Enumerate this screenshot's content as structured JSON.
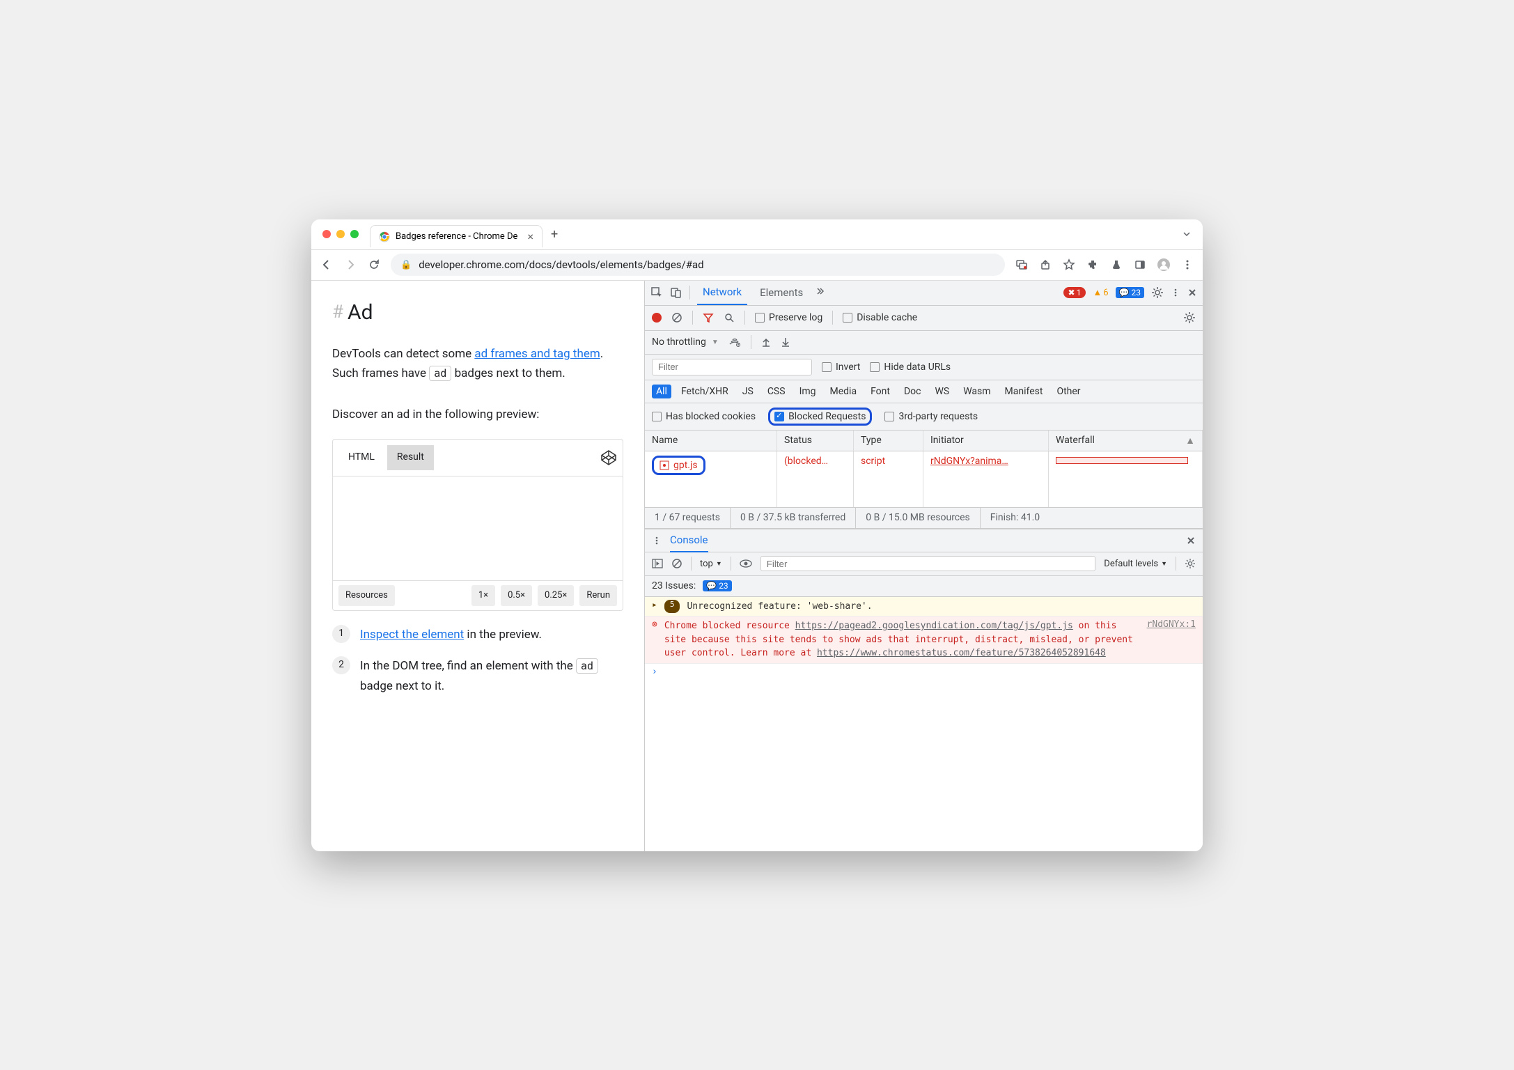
{
  "browser": {
    "tab_title": "Badges reference - Chrome De",
    "url": "developer.chrome.com/docs/devtools/elements/badges/#ad"
  },
  "page": {
    "heading": "Ad",
    "para1_prefix": "DevTools can detect some ",
    "para1_link": "ad frames and tag them",
    "para1_mid": ". Such frames have ",
    "para1_badge": "ad",
    "para1_suffix": " badges next to them.",
    "para2": "Discover an ad in the following preview:",
    "codepen": {
      "tab_html": "HTML",
      "tab_result": "Result",
      "footer_resources": "Resources",
      "footer_1x": "1×",
      "footer_05x": "0.5×",
      "footer_025x": "0.25×",
      "footer_rerun": "Rerun"
    },
    "step1_link": "Inspect the element",
    "step1_suffix": " in the preview.",
    "step2_prefix": "In the DOM tree, find an element with the ",
    "step2_badge": "ad",
    "step2_suffix": " badge next to it."
  },
  "devtools": {
    "tabs": {
      "network": "Network",
      "elements": "Elements"
    },
    "error_count": "1",
    "warn_count": "6",
    "msg_count": "23",
    "network": {
      "preserve_log": "Preserve log",
      "disable_cache": "Disable cache",
      "throttling": "No throttling",
      "filter_placeholder": "Filter",
      "invert": "Invert",
      "hide_data_urls": "Hide data URLs",
      "types": {
        "all": "All",
        "fetch": "Fetch/XHR",
        "js": "JS",
        "css": "CSS",
        "img": "Img",
        "media": "Media",
        "font": "Font",
        "doc": "Doc",
        "ws": "WS",
        "wasm": "Wasm",
        "manifest": "Manifest",
        "other": "Other"
      },
      "has_blocked_cookies": "Has blocked cookies",
      "blocked_requests": "Blocked Requests",
      "third_party": "3rd-party requests",
      "cols": {
        "name": "Name",
        "status": "Status",
        "type": "Type",
        "initiator": "Initiator",
        "waterfall": "Waterfall"
      },
      "row": {
        "name": "gpt.js",
        "status": "(blocked…",
        "type": "script",
        "initiator": "rNdGNYx?anima…"
      },
      "summary": {
        "requests": "1 / 67 requests",
        "transferred": "0 B / 37.5 kB transferred",
        "resources": "0 B / 15.0 MB resources",
        "finish": "Finish: 41.0"
      }
    },
    "console": {
      "tab": "Console",
      "context": "top",
      "filter_placeholder": "Filter",
      "levels": "Default levels",
      "issues_label": "23 Issues:",
      "issues_count": "23",
      "warn_count": "5",
      "warn_msg": "Unrecognized feature: 'web-share'.",
      "err_prefix": "Chrome blocked resource ",
      "err_url1": "https://pagead2.googlesyndication.com/tag/js/gpt.js",
      "err_mid": " on this site because this site tends to show ads that interrupt, distract, mislead, or prevent user control. Learn more at ",
      "err_url2": "https://www.chromestatus.com/feature/5738264052891648",
      "err_src": "rNdGNYx:1"
    }
  }
}
